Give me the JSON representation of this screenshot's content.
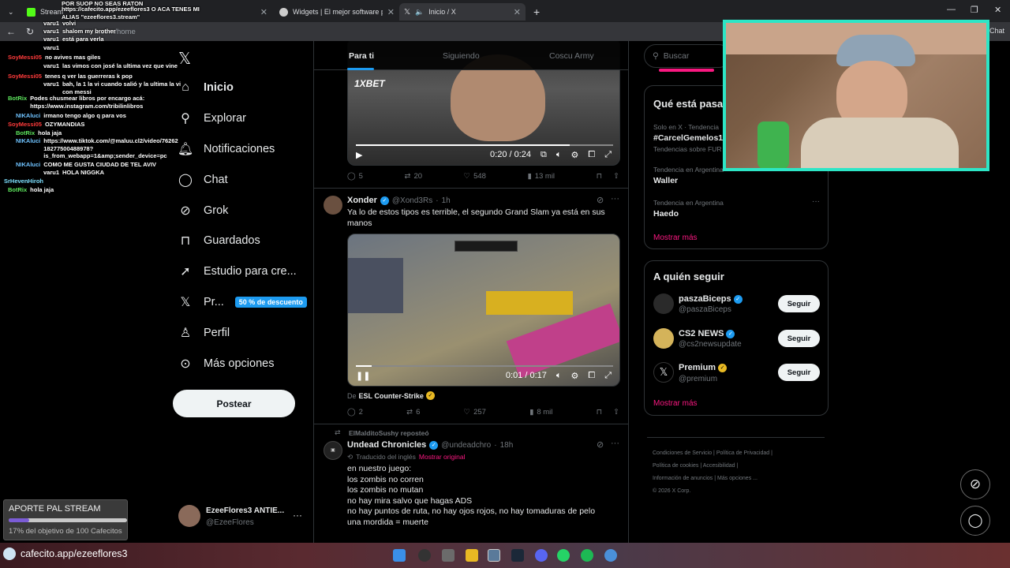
{
  "browser": {
    "tabs": [
      {
        "label": "Stream"
      },
      {
        "label": "https://cafecito.app/ezeeflores3 O ACA TENES MI ALIAS \"ezeeflores3.stream\""
      },
      {
        "label": "Widgets | El mejor software para p"
      },
      {
        "label": "Inicio / X"
      }
    ],
    "url": "x.com/home"
  },
  "nav": {
    "items": [
      {
        "label": "Inicio",
        "icon": "home-icon"
      },
      {
        "label": "Explorar",
        "icon": "search-icon"
      },
      {
        "label": "Notificaciones",
        "icon": "bell-icon"
      },
      {
        "label": "Chat",
        "icon": "chat-icon"
      },
      {
        "label": "Grok",
        "icon": "grok-icon"
      },
      {
        "label": "Guardados",
        "icon": "bookmark-icon"
      },
      {
        "label": "Estudio para cre...",
        "icon": "rocket-icon"
      },
      {
        "label": "Pr...",
        "icon": "x-icon",
        "badge": "50 % de descuento"
      },
      {
        "label": "Perfil",
        "icon": "person-icon"
      },
      {
        "label": "Más opciones",
        "icon": "more-icon"
      }
    ],
    "post_button": "Postear",
    "account": {
      "name": "EzeeFlores3 ANTIE...",
      "handle": "@EzeeFlores"
    }
  },
  "feed": {
    "tabs": [
      "Para ti",
      "Siguiendo",
      "Coscu Army"
    ],
    "tweet1": {
      "video_time": "0:20 / 0:24",
      "replies": "5",
      "reposts": "20",
      "likes": "548",
      "views": "13 mil",
      "overlay_brand": "1XBET"
    },
    "tweet2": {
      "name": "Xonder",
      "handle": "@Xond3Rs",
      "time": "1h",
      "text": "Ya lo de estos tipos es terrible, el segundo Grand Slam ya está en sus manos",
      "video_time": "0:01 / 0:17",
      "from_prefix": "De",
      "from_source": "ESL Counter-Strike",
      "replies": "2",
      "reposts": "6",
      "likes": "257",
      "views": "8 mil"
    },
    "tweet3": {
      "reposted_by": "ElMalditoSushy reposteó",
      "name": "Undead Chronicles",
      "handle": "@undeadchro",
      "time": "18h",
      "translated": "Traducido del inglés",
      "show_original": "Mostrar original",
      "lines": [
        "en nuestro juego:",
        "los zombis no corren",
        "los zombis no mutan",
        "no hay mira salvo que hagas ADS",
        "no hay puntos de ruta, no hay ojos rojos, no hay tomaduras de pelo",
        "una mordida = muerte"
      ]
    }
  },
  "sidebar": {
    "search_placeholder": "Buscar",
    "trends_title": "Qué está pasa",
    "trends": [
      {
        "category": "Solo en X · Tendencia",
        "name": "#CarcelGemelos1",
        "extra": "Tendencias sobre FUR"
      },
      {
        "category": "Tendencia en Argentina",
        "name": "Waller"
      },
      {
        "category": "Tendencia en Argentina",
        "name": "Haedo"
      }
    ],
    "show_more": "Mostrar más",
    "follow_title": "A quién seguir",
    "follow": [
      {
        "name": "paszaBiceps",
        "handle": "@paszaBiceps",
        "button": "Seguir"
      },
      {
        "name": "CS2 NEWS",
        "handle": "@cs2newsupdate",
        "button": "Seguir"
      },
      {
        "name": "Premium",
        "handle": "@premium",
        "button": "Seguir"
      }
    ],
    "show_more2": "Mostrar más",
    "footer": [
      "Condiciones de Servicio",
      "Política de Privacidad",
      "Política de cookies",
      "Accesibilidad",
      "Información de anuncios",
      "Más opciones ...",
      "© 2026 X Corp."
    ]
  },
  "chat": [
    {
      "user": "",
      "msg": "POR SUOP NO SEAS RATON"
    },
    {
      "user": "",
      "msg": "https://cafecito.app/ezeeflores3 O ACA TENES MI ALIAS \"ezeeflores3.stream\""
    },
    {
      "user": "varu1",
      "msg": "volvi"
    },
    {
      "user": "varu1",
      "msg": "shalom my brother"
    },
    {
      "user": "varu1",
      "msg": "está para verla"
    },
    {
      "user": "varu1",
      "msg": ""
    },
    {
      "user": "SoyMessi05",
      "msg": "no avives mas giles"
    },
    {
      "user": "varu1",
      "msg": "las vimos con josé la ultima vez que vine"
    },
    {
      "user": "SoyMessi05",
      "msg": "tenes q ver las guerreras k pop"
    },
    {
      "user": "varu1",
      "msg": "bah, la 1 la vi cuando salió y la ultima la vi con messi"
    },
    {
      "user": "BotRix",
      "msg": "Podes chusmear libros por encargo acá: https://www.instagram.com/tribilinlibros"
    },
    {
      "user": "NIKAluci",
      "msg": "irmano tengo algo q para vos"
    },
    {
      "user": "SoyMessi05",
      "msg": "OZYMANDIAS"
    },
    {
      "user": "BotRix",
      "msg": "hola jaja"
    },
    {
      "user": "NIKAluci",
      "msg": "https://www.tiktok.com/@maluu.cl2/video/76262 18277500488978? is_from_webapp=1&amp;sender_device=pc"
    },
    {
      "user": "NIKAluci",
      "msg": "COMO ME GUSTA CIUDAD DE TEL AVIV"
    },
    {
      "user": "varu1",
      "msg": "HOLA NIGGKA"
    },
    {
      "user": "SrHevenHiroh",
      "msg": ""
    },
    {
      "user": "BotRix",
      "msg": "hola jaja"
    }
  ],
  "aporte": {
    "title": "APORTE PAL STREAM",
    "progress": 0.17,
    "subtitle": "17% del objetivo de 100 Cafecitos"
  },
  "cafecito_url": "cafecito.app/ezeeflores3",
  "colors": {
    "accent": "#1d9bf0",
    "pink": "#f91880",
    "cam_border": "#2de6c6"
  }
}
